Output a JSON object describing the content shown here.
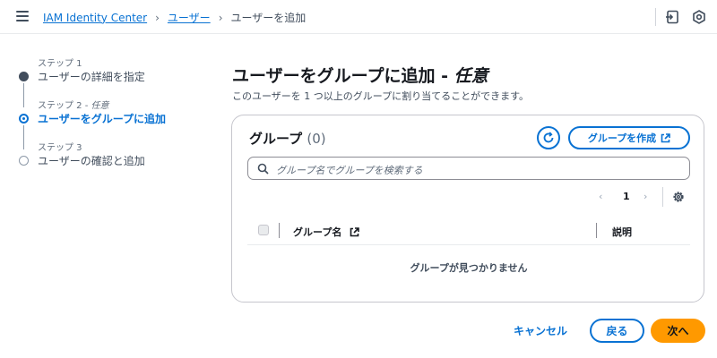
{
  "header": {
    "breadcrumbs": [
      "IAM Identity Center",
      "ユーザー"
    ],
    "current": "ユーザーを追加",
    "icons": [
      "menu-icon",
      "notifications-panel-icon",
      "settings-hex-icon"
    ]
  },
  "steps": [
    {
      "number": "ステップ 1",
      "optional": "",
      "title": "ユーザーの詳細を指定",
      "state": "done"
    },
    {
      "number": "ステップ 2 - ",
      "optional": "任意",
      "title": "ユーザーをグループに追加",
      "state": "active"
    },
    {
      "number": "ステップ 3",
      "optional": "",
      "title": "ユーザーの確認と追加",
      "state": "future"
    }
  ],
  "main": {
    "title": "ユーザーをグループに追加 - ",
    "title_optional": "任意",
    "description": "このユーザーを 1 つ以上のグループに割り当てることができます。"
  },
  "groups_panel": {
    "title": "グループ",
    "count": "(0)",
    "create_button": "グループを作成",
    "search_placeholder": "グループ名でグループを検索する",
    "page_number": "1",
    "columns": [
      "グループ名",
      "説明"
    ],
    "empty_message": "グループが見つかりません"
  },
  "footer": {
    "cancel": "キャンセル",
    "back": "戻る",
    "next": "次へ"
  },
  "colors": {
    "accent": "#0972d3",
    "primary_button": "#ff9900",
    "text": "#16191f"
  }
}
